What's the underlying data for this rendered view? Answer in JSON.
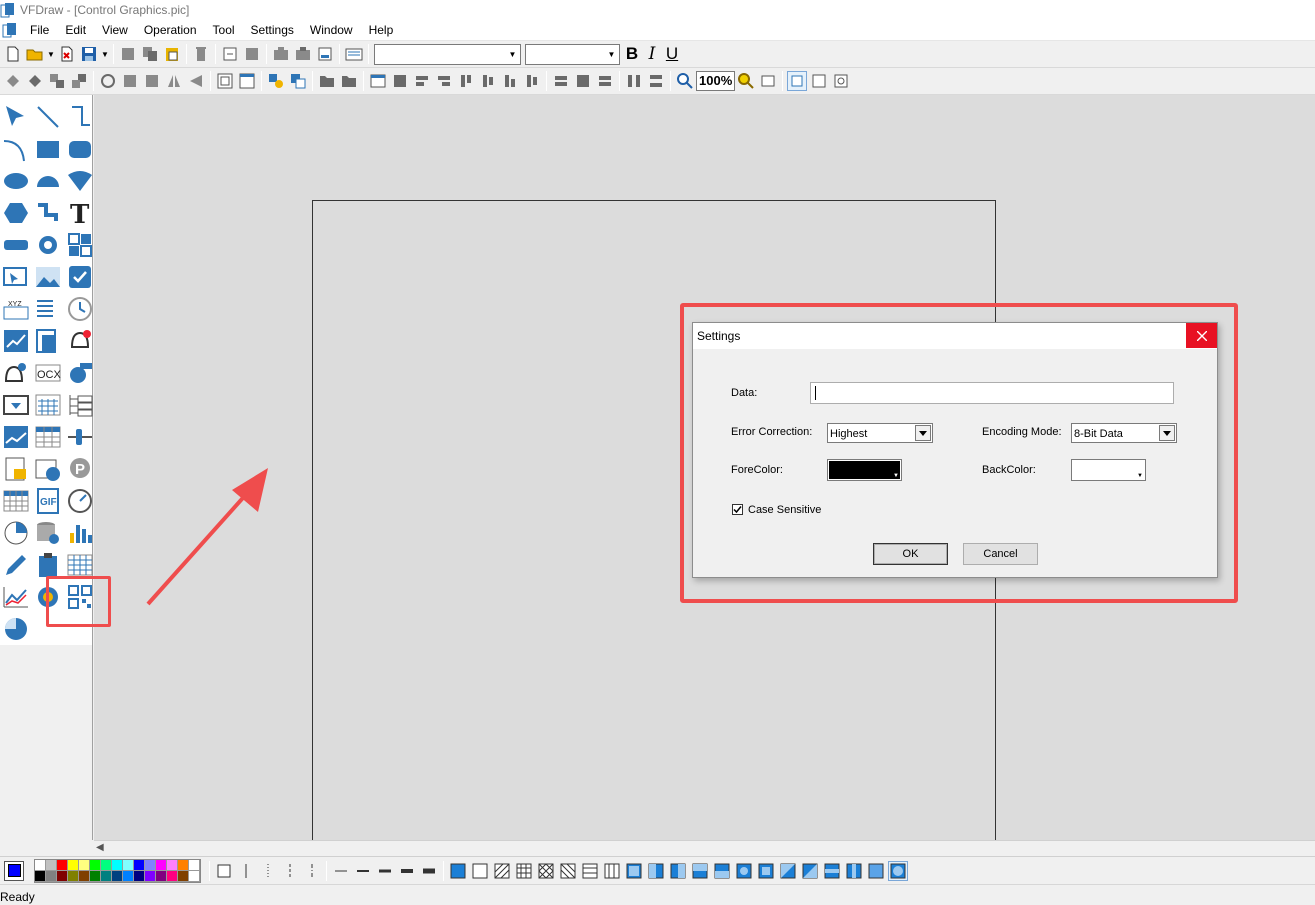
{
  "window": {
    "app_name": "VFDraw",
    "title": "VFDraw - [Control Graphics.pic]"
  },
  "menu": [
    "File",
    "Edit",
    "View",
    "Operation",
    "Tool",
    "Settings",
    "Window",
    "Help"
  ],
  "toolbar_format": {
    "bold": "B",
    "italic": "I",
    "underline": "U",
    "zoom": "100%",
    "font_name": "",
    "font_size": ""
  },
  "palette": {
    "current_color": "#0000ff",
    "swatches_top": [
      "#ffffff",
      "#c0c0c0",
      "#ff0000",
      "#ffff00",
      "#ffff80",
      "#00ff00",
      "#00ff80",
      "#00ffff",
      "#80ffff",
      "#0000ff",
      "#8080ff",
      "#ff00ff",
      "#ff80ff",
      "#ff8000",
      "#ffffff"
    ],
    "swatches_bottom": [
      "#000000",
      "#808080",
      "#800000",
      "#808000",
      "#804000",
      "#008000",
      "#008080",
      "#004080",
      "#0080ff",
      "#000080",
      "#8000ff",
      "#800080",
      "#ff0080",
      "#804000",
      "#ffffff"
    ]
  },
  "status": {
    "text": "Ready"
  },
  "dialog": {
    "title": "Settings",
    "data_label": "Data:",
    "data_value": "",
    "error_correction_label": "Error Correction:",
    "error_correction_value": "Highest",
    "encoding_mode_label": "Encoding Mode:",
    "encoding_mode_value": "8-Bit Data",
    "forecolor_label": "ForeColor:",
    "forecolor_value": "#000000",
    "backcolor_label": "BackColor:",
    "backcolor_value": "#ffffff",
    "case_sensitive_label": "Case Sensitive",
    "case_sensitive_checked": true,
    "ok_label": "OK",
    "cancel_label": "Cancel"
  },
  "colors": {
    "highlight": "#ef4d4d",
    "close_button": "#e81123",
    "icon_blue": "#2e75b6"
  },
  "toolbox_icons": [
    "pointer-icon",
    "line-icon",
    "polyline-icon",
    "arc-icon",
    "rectangle-icon",
    "rounded-rect-icon",
    "ellipse-icon",
    "semicircle-icon",
    "sector-icon",
    "polygon-icon",
    "pipe-icon",
    "text-icon",
    "button-icon",
    "gear-icon",
    "grid-icon",
    "input-icon",
    "image-icon",
    "checkbox-icon",
    "text-field-icon",
    "list-icon",
    "clock-icon",
    "trend-icon",
    "report-icon",
    "alarm-icon",
    "alarm-settings-icon",
    "ocx-icon",
    "pump-icon",
    "dropdown-icon",
    "calendar-icon",
    "tree-icon",
    "history-trend-icon",
    "table-icon",
    "slider-icon",
    "recipe-icon",
    "schedule-icon",
    "parking-icon",
    "spreadsheet-icon",
    "gif-icon",
    "gauge-icon",
    "pie-chart-icon",
    "database-icon",
    "bar-chart-icon",
    "edit-icon",
    "clipboard-icon",
    "data-grid-icon",
    "line-chart-icon",
    "browser-icon",
    "qr-code-icon",
    "3d-pie-icon"
  ]
}
